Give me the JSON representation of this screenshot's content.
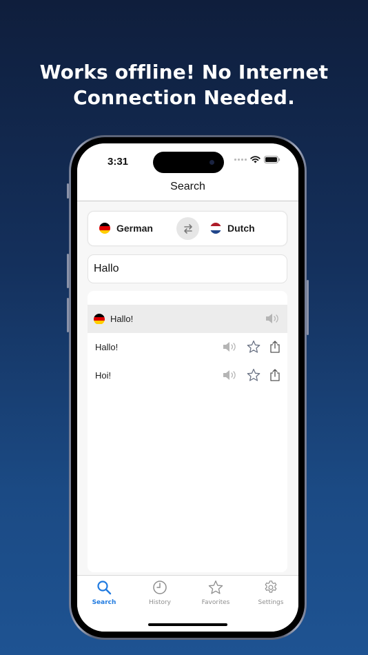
{
  "headline": {
    "line1": "Works offline! No Internet",
    "line2": "Connection Needed."
  },
  "status_bar": {
    "time": "3:31"
  },
  "nav": {
    "title": "Search"
  },
  "language_selector": {
    "source": {
      "label": "German",
      "flag": "germany-flag"
    },
    "target": {
      "label": "Dutch",
      "flag": "netherlands-flag"
    },
    "swap_icon": "swap-arrows-icon"
  },
  "search": {
    "value": "Hallo",
    "placeholder": ""
  },
  "results": {
    "header": {
      "word": "Hallo!",
      "flag": "germany-flag",
      "speaker_icon": "speaker-icon"
    },
    "translations": [
      {
        "word": "Hallo!",
        "icons": [
          "speaker-icon",
          "star-icon",
          "share-icon"
        ]
      },
      {
        "word": "Hoi!",
        "icons": [
          "speaker-icon",
          "star-icon",
          "share-icon"
        ]
      }
    ]
  },
  "tab_bar": {
    "tabs": [
      {
        "label": "Search",
        "icon": "search-icon",
        "active": true
      },
      {
        "label": "History",
        "icon": "clock-icon",
        "active": false
      },
      {
        "label": "Favorites",
        "icon": "star-icon",
        "active": false
      },
      {
        "label": "Settings",
        "icon": "gear-icon",
        "active": false
      }
    ]
  },
  "colors": {
    "accent": "#1f7ae0",
    "background_top": "#0f1e3c",
    "background_bottom": "#1e5392",
    "germany_flag": [
      "#000000",
      "#dd0000",
      "#ffce00"
    ],
    "netherlands_flag": [
      "#ae1c28",
      "#ffffff",
      "#21468b"
    ]
  }
}
